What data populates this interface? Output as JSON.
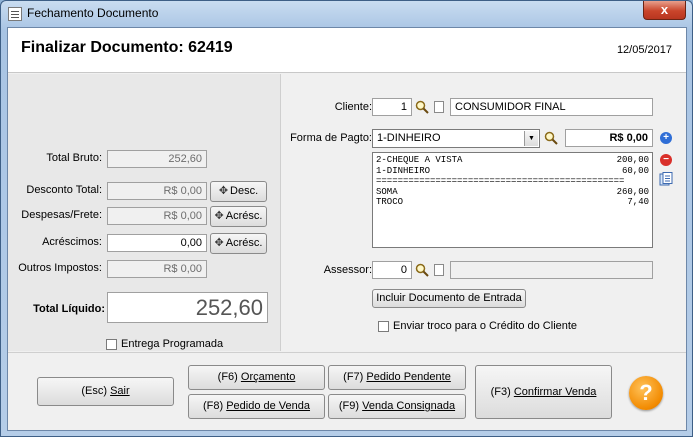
{
  "window": {
    "title": "Fechamento Documento",
    "close_label": "x"
  },
  "header": {
    "title": "Finalizar Documento: 62419",
    "date": "12/05/2017"
  },
  "left": {
    "total_bruto": {
      "label": "Total Bruto:",
      "value": "252,60"
    },
    "desconto": {
      "label": "Desconto Total:",
      "value": "R$ 0,00",
      "button": "Desc."
    },
    "despesas": {
      "label": "Despesas/Frete:",
      "value": "R$ 0,00",
      "button": "Acrésc."
    },
    "acrescimos": {
      "label": "Acréscimos:",
      "value": "0,00",
      "button": "Acrésc."
    },
    "outros": {
      "label": "Outros Impostos:",
      "value": "R$ 0,00"
    },
    "total_liquido": {
      "label": "Total Líquido:",
      "value": "252,60"
    },
    "entrega": {
      "label": "Entrega Programada",
      "checked": false
    }
  },
  "right": {
    "cliente": {
      "label": "Cliente:",
      "code": "1",
      "name": "CONSUMIDOR FINAL"
    },
    "forma": {
      "label": "Forma de Pagto:",
      "selected": "1-DINHEIRO",
      "amount": "R$ 0,00"
    },
    "payments": [
      {
        "name": "2-CHEQUE A VISTA",
        "value": "200,00"
      },
      {
        "name": "1-DINHEIRO",
        "value": "60,00"
      }
    ],
    "separator": "==============================================",
    "summary": [
      {
        "name": "SOMA",
        "value": "260,00"
      },
      {
        "name": "TROCO",
        "value": "7,40"
      }
    ],
    "assessor": {
      "label": "Assessor:",
      "code": "0",
      "name": ""
    },
    "incluir_button": "Incluir Documento de Entrada",
    "troco_credito": {
      "label": "Enviar troco para o Crédito do Cliente",
      "checked": false
    }
  },
  "footer": {
    "sair": {
      "key": "(Esc) ",
      "label": "Sair"
    },
    "orcamento": {
      "key": "(F6) ",
      "label": "Orçamento"
    },
    "pedido_pendente": {
      "key": "(F7) ",
      "label": "Pedido Pendente"
    },
    "pedido_venda": {
      "key": "(F8) ",
      "label": "Pedido de Venda"
    },
    "venda_consignada": {
      "key": "(F9) ",
      "label": "Venda Consignada"
    },
    "confirmar": {
      "key": "(F3) ",
      "label": "Confirmar Venda"
    },
    "help": "?"
  },
  "icons": [
    "document-icon",
    "close-icon",
    "search-icon",
    "add-icon",
    "remove-icon",
    "list-icon",
    "help-icon"
  ],
  "colors": {
    "accent_blue": "#2f6ed6",
    "remove_red": "#d9302a",
    "help_orange": "#f28a00",
    "close_red": "#c9452b"
  }
}
